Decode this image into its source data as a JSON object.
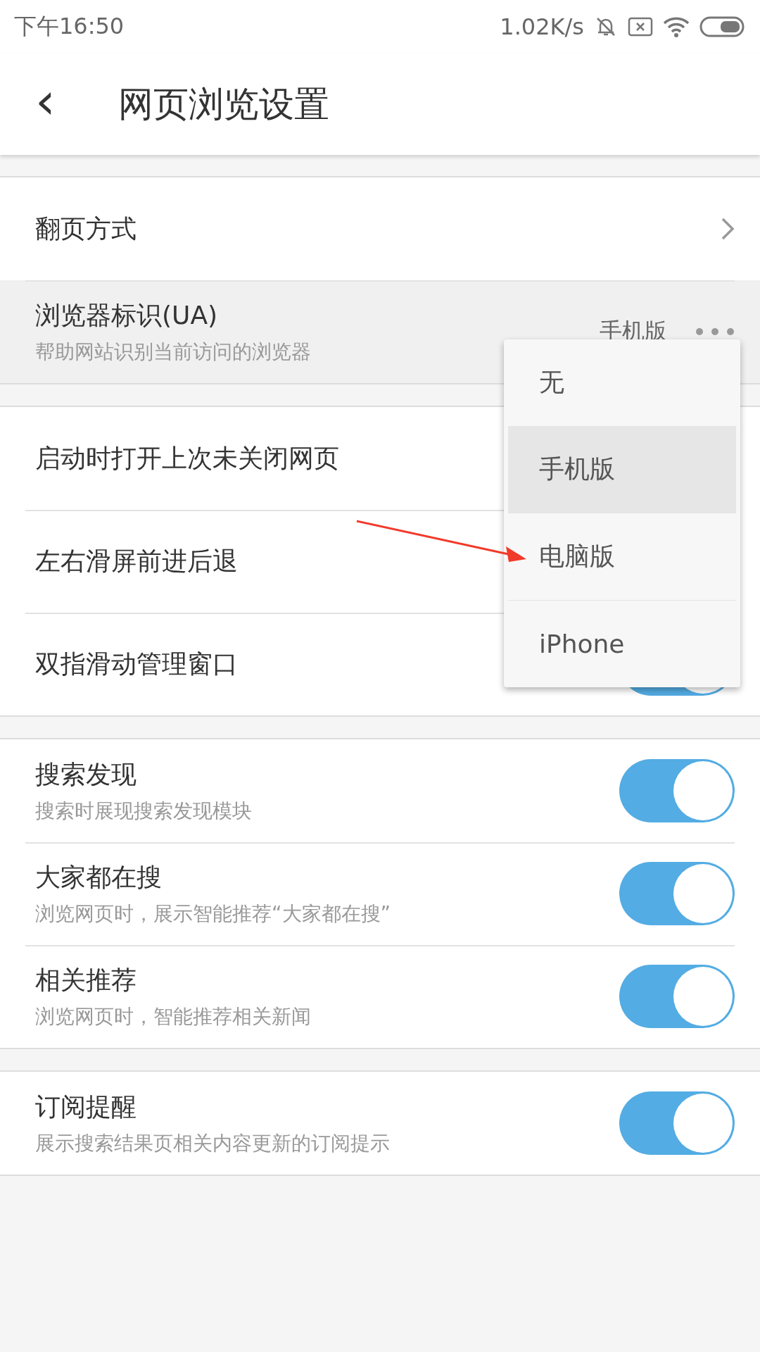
{
  "status_bar": {
    "time": "下午16:50",
    "speed": "1.02K/s"
  },
  "header": {
    "back": "‹",
    "title": "网页浏览设置"
  },
  "groups": [
    {
      "rows": [
        {
          "kind": "link",
          "title": "翻页方式",
          "highlighted": false
        },
        {
          "kind": "value",
          "title": "浏览器标识(UA)",
          "subtitle": "帮助网站识别当前访问的浏览器",
          "value": "手机版",
          "highlighted": true
        }
      ]
    },
    {
      "rows": [
        {
          "kind": "plain",
          "title": "启动时打开上次未关闭网页",
          "highlighted": false
        },
        {
          "kind": "plain",
          "title": "左右滑屏前进后退",
          "highlighted": false
        },
        {
          "kind": "toggle",
          "title": "双指滑动管理窗口",
          "on": true,
          "highlighted": false
        }
      ]
    },
    {
      "rows": [
        {
          "kind": "toggle",
          "title": "搜索发现",
          "subtitle": "搜索时展现搜索发现模块",
          "on": true,
          "highlighted": false
        },
        {
          "kind": "toggle",
          "title": "大家都在搜",
          "subtitle": "浏览网页时，展示智能推荐“大家都在搜”",
          "on": true,
          "highlighted": false
        },
        {
          "kind": "toggle",
          "title": "相关推荐",
          "subtitle": "浏览网页时，智能推荐相关新闻",
          "on": true,
          "highlighted": false
        }
      ]
    },
    {
      "rows": [
        {
          "kind": "toggle",
          "title": "订阅提醒",
          "subtitle": "展示搜索结果页相关内容更新的订阅提示",
          "on": true,
          "highlighted": false
        }
      ]
    }
  ],
  "popup_menu": {
    "items": [
      {
        "label": "无",
        "selected": false
      },
      {
        "label": "手机版",
        "selected": true
      },
      {
        "label": "电脑版",
        "selected": false
      },
      {
        "label": "iPhone",
        "selected": false
      }
    ]
  }
}
